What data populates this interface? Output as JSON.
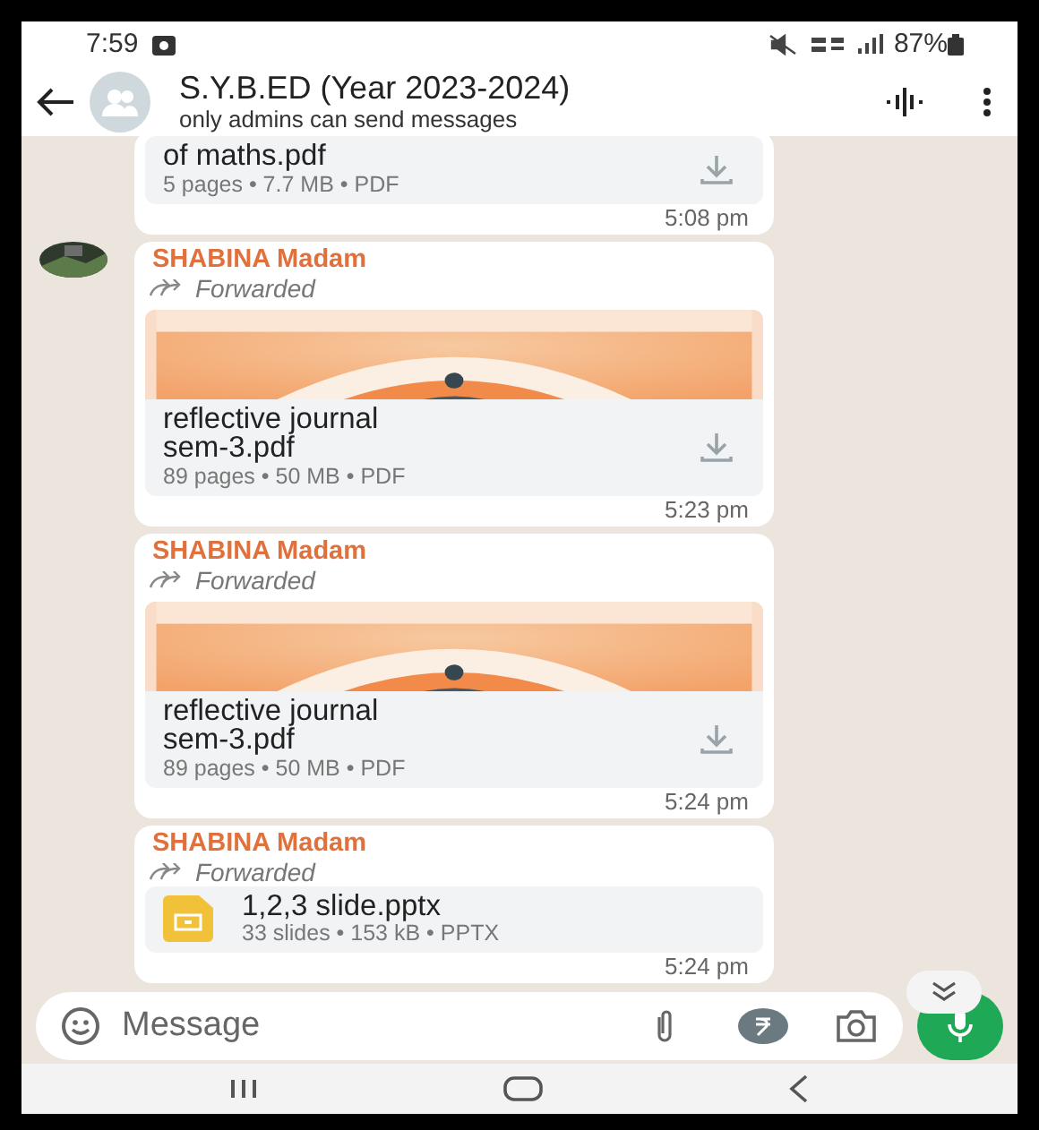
{
  "status_bar": {
    "time": "7:59",
    "battery": "87%"
  },
  "header": {
    "title": "S.Y.B.ED (Year 2023-2024)",
    "subtitle": "only admins can send messages"
  },
  "messages": [
    {
      "kind": "document",
      "show_avatar": false,
      "file_name": "of maths.pdf",
      "file_meta": "5 pages • 7.7 MB • PDF",
      "time": "5:08 pm"
    },
    {
      "kind": "preview",
      "show_avatar": true,
      "sender": "SHABINA Madam",
      "forwarded_label": "Forwarded",
      "file_name": "reflective journal sem-3.pdf",
      "file_meta": "89 pages • 50 MB • PDF",
      "time": "5:23 pm"
    },
    {
      "kind": "preview",
      "show_avatar": false,
      "sender": "SHABINA Madam",
      "forwarded_label": "Forwarded",
      "file_name": "reflective journal sem-3.pdf",
      "file_meta": "89 pages • 50 MB • PDF",
      "time": "5:24 pm"
    },
    {
      "kind": "slides",
      "show_avatar": false,
      "sender": "SHABINA Madam",
      "forwarded_label": "Forwarded",
      "file_name": "1,2,3 slide.pptx",
      "file_meta": "33 slides • 153 kB • PPTX",
      "time": "5:24 pm"
    }
  ],
  "composer": {
    "placeholder": "Message"
  }
}
